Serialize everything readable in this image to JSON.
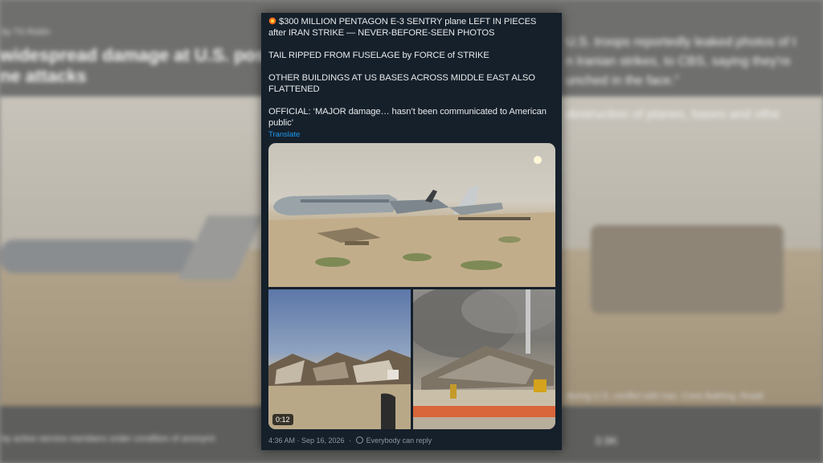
{
  "background": {
    "left_byline": "by TS Robin",
    "left_headline_1": "widespread damage at U.S. pos",
    "left_headline_2": "ne attacks",
    "right_text_1": "U.S. troops reportedly leaked photos of t",
    "right_text_2": "n Iranian strikes, to CBS, saying they're",
    "right_text_3": "unched in the face.”",
    "right_text_4": "destruction of planes, bases and othe",
    "left_caption": "by active service members under condition of anonymi",
    "right_caption": "during U.S. conflict with Iran. Corie Bathing, Roadi",
    "right_stat": "3.9K"
  },
  "tweet": {
    "emoji_icon": "collision-icon",
    "line1": "$300 MILLION PENTAGON E-3 SENTRY plane LEFT IN PIECES after IRAN STRIKE — NEVER-BEFORE-SEEN PHOTOS",
    "line2": "TAIL RIPPED FROM FUSELAGE by FORCE of STRIKE",
    "line3": "OTHER BUILDINGS AT US BASES ACROSS MIDDLE EAST ALSO FLATTENED",
    "line4": "OFFICIAL: ‘MAJOR damage… hasn’t been communicated to American public’",
    "translate": "Translate",
    "video_duration": "0:12",
    "timestamp": "4:36 AM · Sep 16, 2026",
    "reply_setting": "Everybody can reply"
  },
  "colors": {
    "card_bg": "#15202b",
    "text": "#e7e9ea",
    "link": "#1d9bf0",
    "meta": "#8b98a5"
  }
}
